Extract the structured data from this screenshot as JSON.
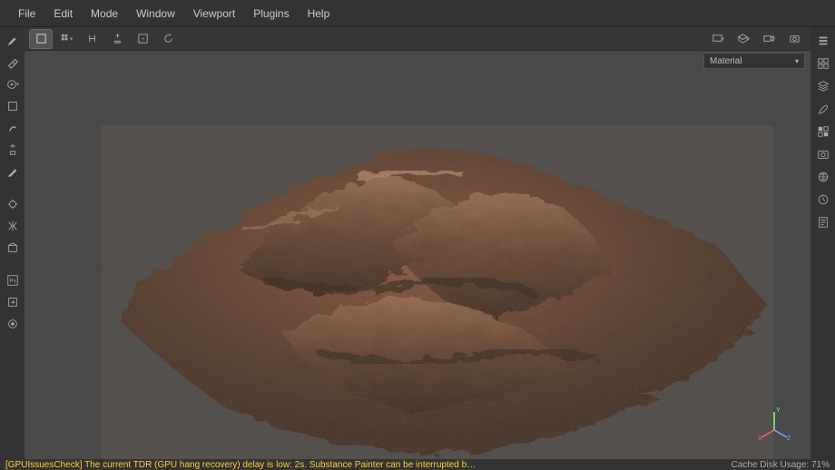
{
  "menu": {
    "items": [
      "File",
      "Edit",
      "Mode",
      "Window",
      "Viewport",
      "Plugins",
      "Help"
    ]
  },
  "leftTools": [
    {
      "name": "brush-icon"
    },
    {
      "name": "eraser-icon"
    },
    {
      "name": "projection-icon"
    },
    {
      "name": "polyfill-icon"
    },
    {
      "name": "smudge-icon"
    },
    {
      "name": "clone-icon"
    },
    {
      "name": "material-picker-icon"
    },
    {
      "name": "bake-icon"
    },
    {
      "name": "mirror-icon"
    },
    {
      "name": "resource-icon"
    },
    {
      "name": "ps-icon"
    },
    {
      "name": "export-icon"
    },
    {
      "name": "settings-icon"
    }
  ],
  "viewportToolbar": {
    "left": [
      {
        "name": "perspective-icon",
        "active": true
      },
      {
        "name": "grid-icon"
      },
      {
        "name": "symmetry-icon"
      },
      {
        "name": "pivot-icon"
      },
      {
        "name": "frame-icon"
      },
      {
        "name": "refresh-icon"
      }
    ],
    "right": [
      {
        "name": "display-icon"
      },
      {
        "name": "shader-icon"
      },
      {
        "name": "camera-icon"
      },
      {
        "name": "capture-icon"
      }
    ]
  },
  "materialDropdown": {
    "label": "Material"
  },
  "rightTools": [
    {
      "name": "properties-icon"
    },
    {
      "name": "texture-set-icon"
    },
    {
      "name": "layers-icon"
    },
    {
      "name": "brush-settings-icon"
    },
    {
      "name": "toolbox-icon"
    },
    {
      "name": "screenshot-icon"
    },
    {
      "name": "world-icon"
    },
    {
      "name": "history-icon"
    },
    {
      "name": "log-icon"
    }
  ],
  "gizmo": {
    "x": "X",
    "y": "Y",
    "z": "Z"
  },
  "status": {
    "warning": "[GPUIssuesCheck] The current TDR (GPU hang recovery) delay is low: 2s. Substance Painter can be interrupted b…",
    "cache": "Cache Disk Usage: 71%"
  }
}
